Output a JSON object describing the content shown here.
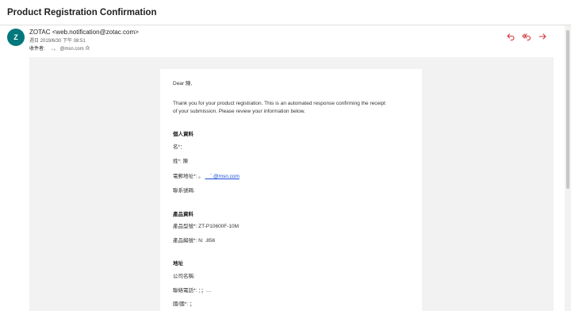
{
  "subject": "Product Registration Confirmation",
  "sender": {
    "avatar_letter": "Z",
    "from": "ZOTAC <web.notification@zotac.com>",
    "date": "週日 2019/6/30 下午 08:51",
    "recipients_label": "收件者:",
    "recipients_value": "、。    @msn.com 众"
  },
  "actions": {
    "reply_icon": "reply-icon",
    "reply_all_icon": "reply-all-icon",
    "forward_icon": "forward-icon",
    "color": "#d13438"
  },
  "body": {
    "greeting": "Dear        陳,",
    "intro_line1": "Thank you for your product registration. This is an automated response confirming the receipt",
    "intro_line2": "of your submission. Please review your information below.",
    "personal": {
      "heading": "個人資料",
      "name_label": "名*：",
      "surname_label": "姓*: 陳",
      "email_label": "電郵地址*: 。",
      "email_value": "　`   @msn.com",
      "phone_label": "聯系號碼:"
    },
    "product": {
      "heading": "產品資料",
      "model_label": "產品型號*: ZT-P10600F-10M",
      "serial_label": "產品編號*: N:              .856"
    },
    "address": {
      "heading": "地址",
      "company_label": "公司名稱:",
      "contact_label": "聯絡電話*: ：；…",
      "country_label": "國/國*:                           ；"
    }
  }
}
